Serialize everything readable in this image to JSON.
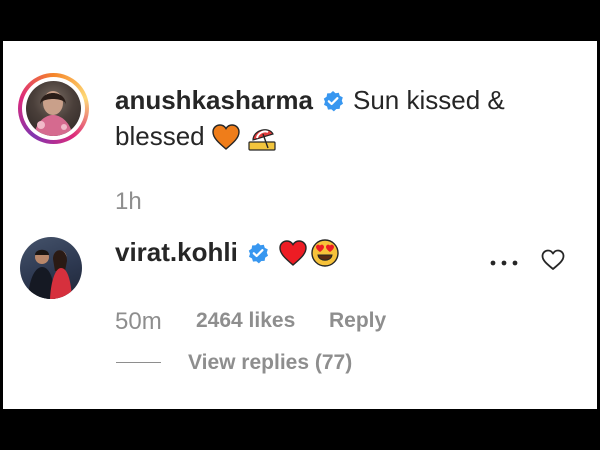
{
  "comments": [
    {
      "username": "anushkasharma",
      "verified": true,
      "text_line1": "Sun kissed &",
      "text_line2": "blessed",
      "emojis": [
        "orange-heart",
        "umbrella-on-ground"
      ],
      "time": "1h"
    },
    {
      "username": "virat.kohli",
      "verified": true,
      "emojis": [
        "red-heart",
        "heart-eyes-face"
      ],
      "time": "50m",
      "likes": "2464 likes",
      "reply_label": "Reply",
      "view_replies": "View replies (77)"
    }
  ],
  "colors": {
    "text": "#262626",
    "muted": "#8e8e8e",
    "verified": "#3897f0",
    "red_heart": "#ed4956",
    "orange_heart": "#ef7d1a"
  }
}
